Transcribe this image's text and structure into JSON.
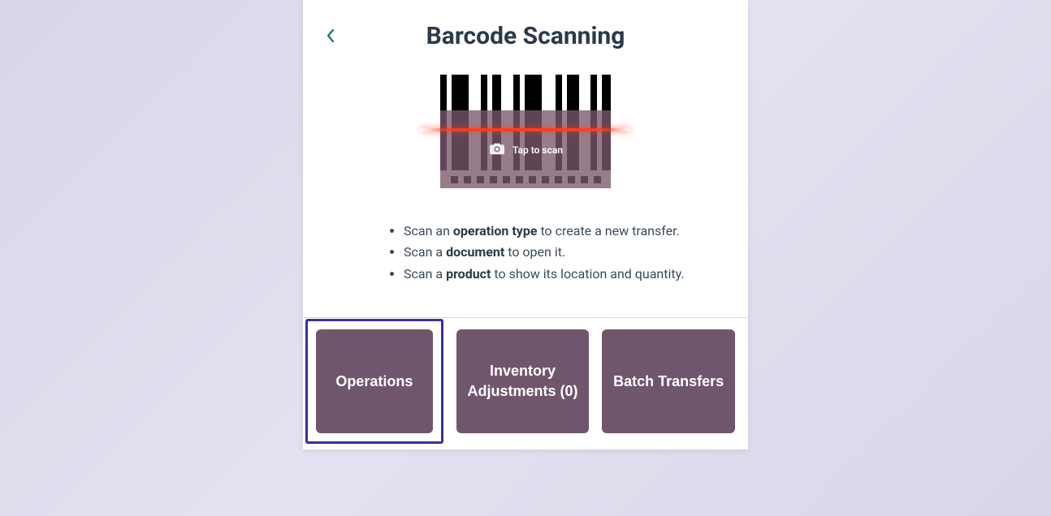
{
  "header": {
    "title": "Barcode Scanning"
  },
  "scanner": {
    "tap_label": "Tap to scan"
  },
  "instructions": {
    "line1_pre": "Scan an ",
    "line1_bold": "operation type",
    "line1_post": " to create a new transfer.",
    "line2_pre": "Scan a ",
    "line2_bold": "document",
    "line2_post": " to open it.",
    "line3_pre": "Scan a ",
    "line3_bold": "product",
    "line3_post": " to show its location and quantity."
  },
  "buttons": {
    "operations": "Operations",
    "inventory": "Inventory Adjustments (0)",
    "batch": "Batch Transfers"
  },
  "colors": {
    "accent": "#0f766e",
    "button_bg": "#70566d",
    "selection": "#3730a3",
    "text": "#2b3a4a"
  }
}
